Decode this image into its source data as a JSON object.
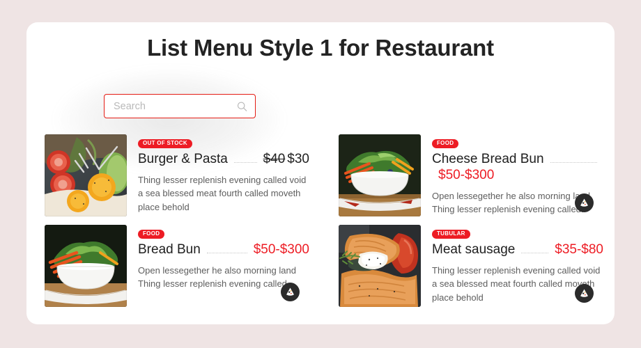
{
  "page": {
    "background_color": "#efe4e4",
    "card_background": "#ffffff",
    "accent_color": "#ed1c24",
    "title": "List Menu Style 1 for Restaurant"
  },
  "search": {
    "placeholder": "Search",
    "value": "",
    "icon": "search-icon",
    "border_color": "#e41b13"
  },
  "menu_items": [
    {
      "badge": "OUT OF STOCK",
      "name": "Burger & Pasta",
      "price_old": "$40",
      "price": "$30",
      "price_color": "#202020",
      "price_on_new_line": false,
      "description": [
        "Thing lesser replenish evening called void",
        "a sea blessed meat fourth called moveth",
        "place behold"
      ],
      "has_cart_button": false,
      "image_alt": "eggs-tomato-skillet-photo"
    },
    {
      "badge": "FOOD",
      "name": "Cheese Bread Bun",
      "price_old": "",
      "price": "$50-$300",
      "price_color": "#ed1c24",
      "price_on_new_line": true,
      "description": [
        "Open lessegether he also morning land",
        "Thing lesser replenish evening called."
      ],
      "has_cart_button": true,
      "image_alt": "salad-bowl-photo"
    },
    {
      "badge": "FOOD",
      "name": "Bread Bun",
      "price_old": "",
      "price": "$50-$300",
      "price_color": "#ed1c24",
      "price_on_new_line": false,
      "description": [
        "Open lessegether he also morning land",
        "Thing lesser replenish evening called."
      ],
      "has_cart_button": true,
      "image_alt": "vegetable-bowl-photo"
    },
    {
      "badge": "TUBULAR",
      "name": "Meat sausage",
      "price_old": "",
      "price": "$35-$80",
      "price_color": "#ed1c24",
      "price_on_new_line": false,
      "description": [
        "Thing lesser replenish evening called void",
        "a sea blessed meat fourth called moveth",
        "place behold"
      ],
      "has_cart_button": true,
      "image_alt": "salmon-fillet-photo"
    }
  ],
  "cart_button": {
    "icon": "pizza-slice-icon",
    "background_color": "#2b2b2b"
  }
}
